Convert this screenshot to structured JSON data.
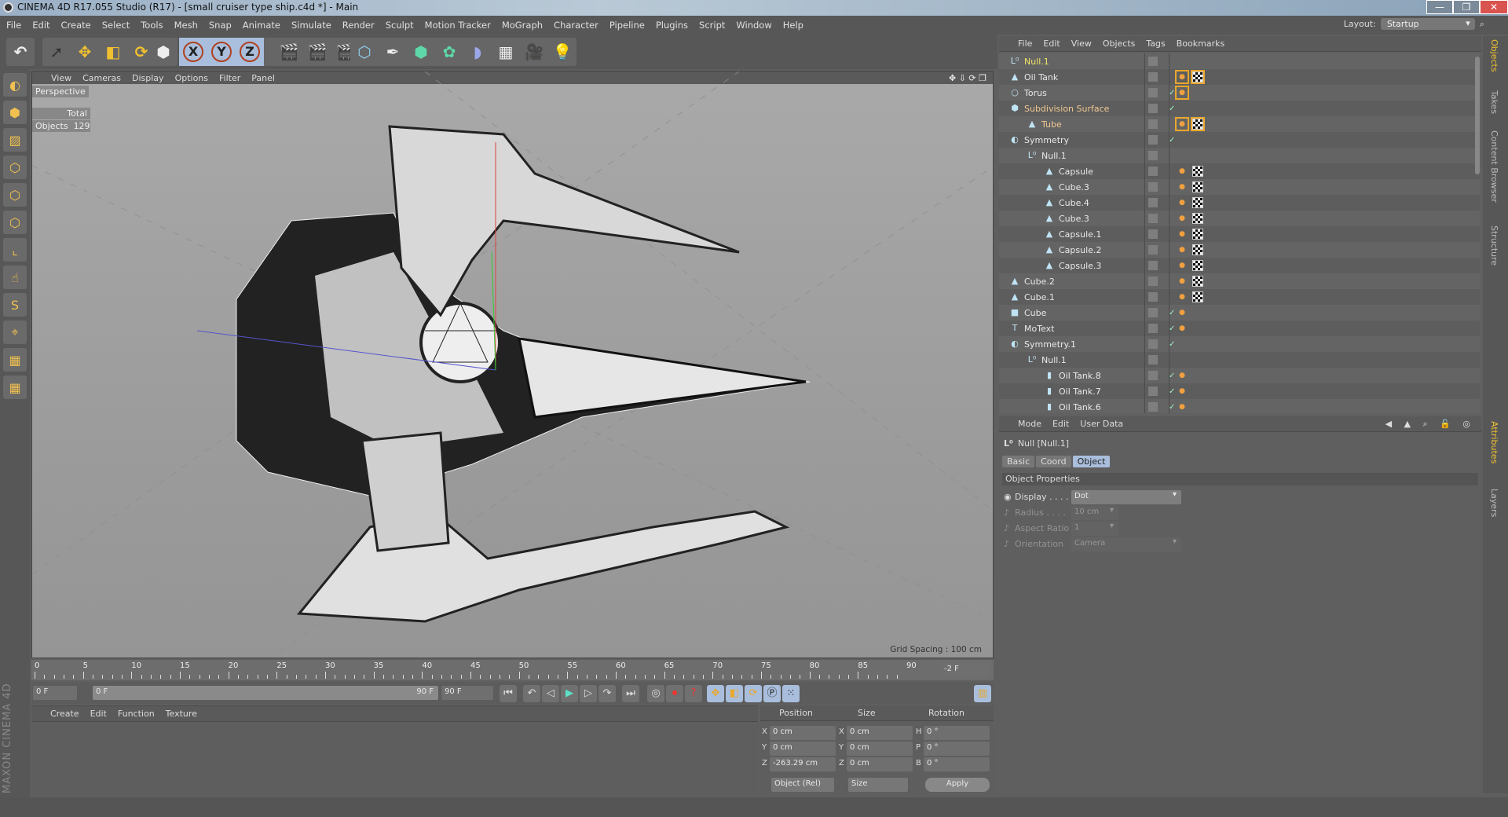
{
  "window": {
    "title": "CINEMA 4D R17.055 Studio (R17) - [small cruiser type ship.c4d *] - Main",
    "minimize": "—",
    "restore": "❐",
    "close": "✕"
  },
  "menubar": [
    "File",
    "Edit",
    "Create",
    "Select",
    "Tools",
    "Mesh",
    "Snap",
    "Animate",
    "Simulate",
    "Render",
    "Sculpt",
    "Motion Tracker",
    "MoGraph",
    "Character",
    "Pipeline",
    "Plugins",
    "Script",
    "Window",
    "Help"
  ],
  "layout": {
    "label": "Layout:",
    "value": "Startup"
  },
  "toolbar": {
    "icons": [
      "undo-icon",
      "live-selection-icon",
      "move-icon",
      "scale-icon",
      "rotate-icon",
      "recent-tool-icon",
      "x-axis-icon",
      "y-axis-icon",
      "z-axis-icon",
      "coordinate-system-icon",
      "render-view-icon",
      "render-picture-viewer-icon",
      "render-settings-icon",
      "cube-icon",
      "pen-icon",
      "subdivision-icon",
      "cloner-icon",
      "deformer-icon",
      "floor-icon",
      "camera-icon",
      "light-icon"
    ],
    "axis_labels": [
      "X",
      "Y",
      "Z"
    ]
  },
  "viewport": {
    "menu": [
      "View",
      "Cameras",
      "Display",
      "Options",
      "Filter",
      "Panel"
    ],
    "camera": "Perspective",
    "stats_header": "Total",
    "stats_label": "Objects",
    "stats_value": "129",
    "grid_spacing": "Grid Spacing : 100 cm"
  },
  "timeline": {
    "ticks": [
      "0",
      "5",
      "10",
      "15",
      "20",
      "25",
      "30",
      "35",
      "40",
      "45",
      "50",
      "55",
      "60",
      "65",
      "70",
      "75",
      "80",
      "85",
      "90"
    ],
    "current_frame": "-2 F",
    "start": "0 F",
    "range_start": "0 F",
    "range_end": "90 F",
    "end": "90 F"
  },
  "material_panel": {
    "menu": [
      "Create",
      "Edit",
      "Function",
      "Texture"
    ]
  },
  "coords": {
    "headers": [
      "Position",
      "Size",
      "Rotation"
    ],
    "rows": [
      {
        "pl": "X",
        "pv": "0 cm",
        "sl": "X",
        "sv": "0 cm",
        "rl": "H",
        "rv": "0 °"
      },
      {
        "pl": "Y",
        "pv": "0 cm",
        "sl": "Y",
        "sv": "0 cm",
        "rl": "P",
        "rv": "0 °"
      },
      {
        "pl": "Z",
        "pv": "-263.29 cm",
        "sl": "Z",
        "sv": "0 cm",
        "rl": "B",
        "rv": "0 °"
      }
    ],
    "mode": "Object (Rel)",
    "size_mode": "Size",
    "apply": "Apply"
  },
  "object_manager": {
    "menu": [
      "File",
      "Edit",
      "View",
      "Objects",
      "Tags",
      "Bookmarks"
    ],
    "objects": [
      {
        "name": "Null.1",
        "depth": 0,
        "icon": "null",
        "color": "#f2e36a",
        "check": false,
        "tags": []
      },
      {
        "name": "Oil Tank",
        "depth": 0,
        "icon": "poly",
        "color": "#e8e8e8",
        "check": false,
        "tags": [
          "phong-boxed",
          "material-boxed"
        ]
      },
      {
        "name": "Torus",
        "depth": 0,
        "icon": "torus",
        "color": "#e8e8e8",
        "check": true,
        "tags": [
          "phong-boxed"
        ]
      },
      {
        "name": "Subdivision Surface",
        "depth": 0,
        "icon": "subdiv",
        "color": "#f0c890",
        "check": true,
        "tags": []
      },
      {
        "name": "Tube",
        "depth": 1,
        "icon": "poly",
        "color": "#f0c890",
        "check": false,
        "tags": [
          "phong-boxed",
          "material-boxed"
        ]
      },
      {
        "name": "Symmetry",
        "depth": 0,
        "icon": "symmetry",
        "color": "#e8e8e8",
        "check": true,
        "tags": []
      },
      {
        "name": "Null.1",
        "depth": 1,
        "icon": "null",
        "color": "#e8e8e8",
        "check": false,
        "tags": []
      },
      {
        "name": "Capsule",
        "depth": 2,
        "icon": "poly",
        "color": "#e8e8e8",
        "check": false,
        "tags": [
          "phong",
          "material"
        ]
      },
      {
        "name": "Cube.3",
        "depth": 2,
        "icon": "poly",
        "color": "#e8e8e8",
        "check": false,
        "tags": [
          "phong",
          "material"
        ]
      },
      {
        "name": "Cube.4",
        "depth": 2,
        "icon": "poly",
        "color": "#e8e8e8",
        "check": false,
        "tags": [
          "phong",
          "material"
        ]
      },
      {
        "name": "Cube.3",
        "depth": 2,
        "icon": "poly",
        "color": "#e8e8e8",
        "check": false,
        "tags": [
          "phong",
          "material"
        ]
      },
      {
        "name": "Capsule.1",
        "depth": 2,
        "icon": "poly",
        "color": "#e8e8e8",
        "check": false,
        "tags": [
          "phong",
          "material"
        ]
      },
      {
        "name": "Capsule.2",
        "depth": 2,
        "icon": "poly",
        "color": "#e8e8e8",
        "check": false,
        "tags": [
          "phong",
          "material"
        ]
      },
      {
        "name": "Capsule.3",
        "depth": 2,
        "icon": "poly",
        "color": "#e8e8e8",
        "check": false,
        "tags": [
          "phong",
          "material"
        ]
      },
      {
        "name": "Cube.2",
        "depth": 0,
        "icon": "poly",
        "color": "#e8e8e8",
        "check": false,
        "tags": [
          "phong",
          "material"
        ]
      },
      {
        "name": "Cube.1",
        "depth": 0,
        "icon": "poly",
        "color": "#e8e8e8",
        "check": false,
        "tags": [
          "phong",
          "material"
        ]
      },
      {
        "name": "Cube",
        "depth": 0,
        "icon": "cube",
        "color": "#e8e8e8",
        "check": true,
        "tags": [
          "phong"
        ]
      },
      {
        "name": "MoText",
        "depth": 0,
        "icon": "text",
        "color": "#e8e8e8",
        "check": true,
        "tags": [
          "phong"
        ]
      },
      {
        "name": "Symmetry.1",
        "depth": 0,
        "icon": "symmetry",
        "color": "#e8e8e8",
        "check": true,
        "tags": []
      },
      {
        "name": "Null.1",
        "depth": 1,
        "icon": "null",
        "color": "#e8e8e8",
        "check": false,
        "tags": []
      },
      {
        "name": "Oil Tank.8",
        "depth": 2,
        "icon": "cylinder",
        "color": "#e8e8e8",
        "check": true,
        "tags": [
          "phong"
        ]
      },
      {
        "name": "Oil Tank.7",
        "depth": 2,
        "icon": "cylinder",
        "color": "#e8e8e8",
        "check": true,
        "tags": [
          "phong"
        ]
      },
      {
        "name": "Oil Tank.6",
        "depth": 2,
        "icon": "cylinder",
        "color": "#e8e8e8",
        "check": true,
        "tags": [
          "phong"
        ]
      }
    ]
  },
  "attributes": {
    "menu": [
      "Mode",
      "Edit",
      "User Data"
    ],
    "object_title": "Null [Null.1]",
    "tabs": [
      "Basic",
      "Coord",
      "Object"
    ],
    "active_tab": "Object",
    "section": "Object Properties",
    "props": [
      {
        "label": "Display . . . .",
        "value": "Dot",
        "enabled": true
      },
      {
        "label": "Radius . . . .",
        "value": "10 cm",
        "enabled": false
      },
      {
        "label": "Aspect Ratio",
        "value": "1",
        "enabled": false
      },
      {
        "label": "Orientation",
        "value": "Camera",
        "enabled": false
      }
    ]
  },
  "side_tabs": {
    "top": [
      "Objects",
      "Takes",
      "Content Browser",
      "Structure"
    ],
    "bottom": [
      "Attributes",
      "Layers"
    ]
  },
  "brand": "MAXON CINEMA 4D",
  "colors": {
    "accent": "#e9a72b",
    "selected_tab": "#a9bedc",
    "panel": "#5f5f5f"
  }
}
